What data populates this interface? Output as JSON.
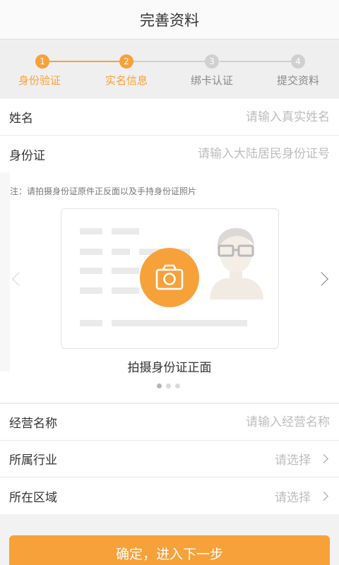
{
  "header": {
    "title": "完善资料"
  },
  "steps": [
    {
      "num": "1",
      "label": "身份验证",
      "state": "done"
    },
    {
      "num": "2",
      "label": "实名信息",
      "state": "active"
    },
    {
      "num": "3",
      "label": "绑卡认证",
      "state": "todo"
    },
    {
      "num": "4",
      "label": "提交资料",
      "state": "todo"
    }
  ],
  "form": {
    "name": {
      "label": "姓名",
      "placeholder": "请输入真实姓名",
      "value": ""
    },
    "id_number": {
      "label": "身份证",
      "placeholder": "请输入大陆居民身份证号",
      "value": ""
    }
  },
  "id_photo": {
    "note": "注：请拍摄身份证原件正反面以及手持身份证照片",
    "caption": "拍摄身份证正面",
    "carousel": {
      "count": 3,
      "active": 0
    }
  },
  "business": {
    "name": {
      "label": "经营名称",
      "placeholder": "请输入经营名称",
      "value": ""
    },
    "industry": {
      "label": "所属行业",
      "value": "请选择"
    },
    "region": {
      "label": "所在区域",
      "value": "请选择"
    }
  },
  "submit_label": "确定，进入下一步",
  "colors": {
    "accent": "#f7a13a",
    "inactive": "#d0d0d0"
  }
}
